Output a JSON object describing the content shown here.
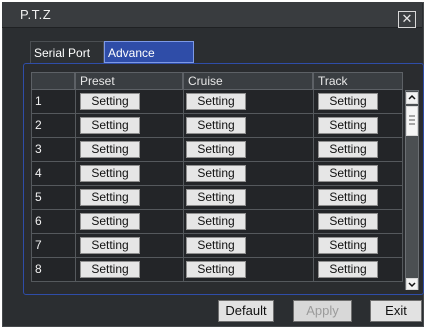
{
  "window": {
    "title": "P.T.Z",
    "close_icon": "close-icon"
  },
  "tabs": [
    {
      "label": "Serial Port",
      "active": false
    },
    {
      "label": "Advance",
      "active": true
    }
  ],
  "table": {
    "columns": [
      "",
      "Preset",
      "Cruise",
      "Track"
    ],
    "rows": [
      {
        "num": "1",
        "preset": "Setting",
        "cruise": "Setting",
        "track": "Setting"
      },
      {
        "num": "2",
        "preset": "Setting",
        "cruise": "Setting",
        "track": "Setting"
      },
      {
        "num": "3",
        "preset": "Setting",
        "cruise": "Setting",
        "track": "Setting"
      },
      {
        "num": "4",
        "preset": "Setting",
        "cruise": "Setting",
        "track": "Setting"
      },
      {
        "num": "5",
        "preset": "Setting",
        "cruise": "Setting",
        "track": "Setting"
      },
      {
        "num": "6",
        "preset": "Setting",
        "cruise": "Setting",
        "track": "Setting"
      },
      {
        "num": "7",
        "preset": "Setting",
        "cruise": "Setting",
        "track": "Setting"
      },
      {
        "num": "8",
        "preset": "Setting",
        "cruise": "Setting",
        "track": "Setting"
      }
    ]
  },
  "footer": {
    "default_label": "Default",
    "apply_label": "Apply",
    "exit_label": "Exit"
  },
  "colors": {
    "accent": "#2f4da8",
    "window_bg": "#2b2e31",
    "panel_bg": "#232528"
  },
  "icons": {
    "close": "close-icon",
    "scroll_up": "chevron-up-icon",
    "scroll_down": "chevron-down-icon"
  }
}
